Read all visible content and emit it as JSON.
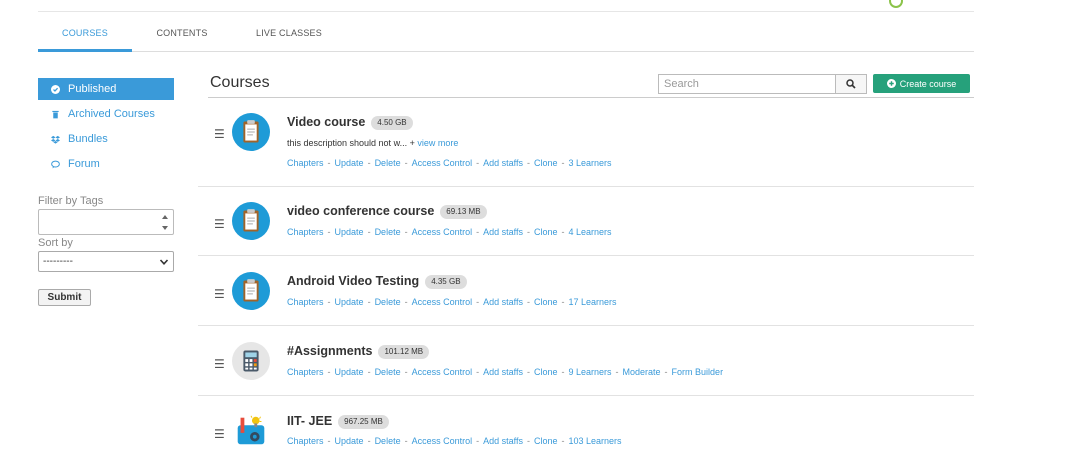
{
  "tabs": [
    {
      "label": "COURSES",
      "active": true
    },
    {
      "label": "CONTENTS",
      "active": false
    },
    {
      "label": "LIVE CLASSES",
      "active": false
    }
  ],
  "sidebar": {
    "items": [
      {
        "label": "Published",
        "icon": "check-circle-icon",
        "active": true
      },
      {
        "label": "Archived Courses",
        "icon": "trash-icon",
        "active": false
      },
      {
        "label": "Bundles",
        "icon": "dropbox-icon",
        "active": false
      },
      {
        "label": "Forum",
        "icon": "chat-icon",
        "active": false
      }
    ],
    "filter_label": "Filter by Tags",
    "sort_label": "Sort by",
    "sort_value": "---------",
    "submit_label": "Submit"
  },
  "main": {
    "title": "Courses",
    "search_placeholder": "Search",
    "create_label": "Create course"
  },
  "courses": [
    {
      "name": "Video course",
      "size": "4.50 GB",
      "icon": "clipboard-icon",
      "description": "this description should not w... + ",
      "view_more": "view more",
      "links": [
        "Chapters",
        "Update",
        "Delete",
        "Access Control",
        "Add staffs",
        "Clone",
        "3 Learners"
      ]
    },
    {
      "name": "video conference course",
      "size": "69.13 MB",
      "icon": "clipboard-icon",
      "links": [
        "Chapters",
        "Update",
        "Delete",
        "Access Control",
        "Add staffs",
        "Clone",
        "4 Learners"
      ]
    },
    {
      "name": "Android Video Testing",
      "size": "4.35 GB",
      "icon": "clipboard-icon",
      "links": [
        "Chapters",
        "Update",
        "Delete",
        "Access Control",
        "Add staffs",
        "Clone",
        "17 Learners"
      ]
    },
    {
      "name": "#Assignments",
      "size": "101.12 MB",
      "icon": "calculator-icon",
      "links": [
        "Chapters",
        "Update",
        "Delete",
        "Access Control",
        "Add staffs",
        "Clone",
        "9 Learners",
        "Moderate",
        "Form Builder"
      ]
    },
    {
      "name": "IIT- JEE",
      "size": "967.25 MB",
      "icon": "science-icon",
      "links": [
        "Chapters",
        "Update",
        "Delete",
        "Access Control",
        "Add staffs",
        "Clone",
        "103 Learners"
      ]
    }
  ],
  "colors": {
    "accent": "#3a9ad9",
    "create": "#26a17b",
    "icon_bg": "#1e9bd7"
  }
}
